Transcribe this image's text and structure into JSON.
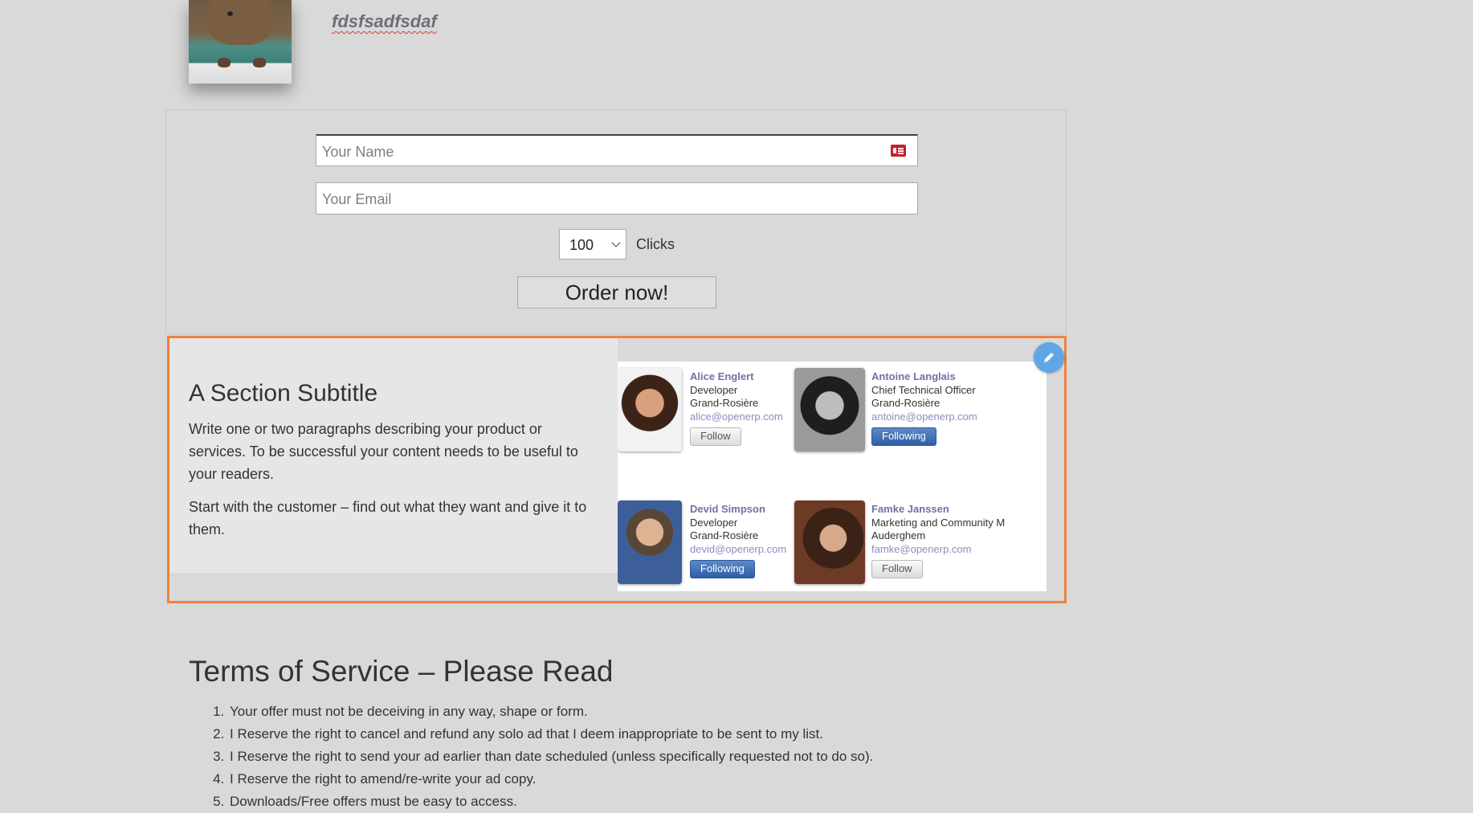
{
  "profile": {
    "name": "fdsfsadfsdaf"
  },
  "order_form": {
    "name_placeholder": "Your Name",
    "email_placeholder": "Your Email",
    "clicks_value": "100",
    "clicks_label": "Clicks",
    "order_button": "Order now!"
  },
  "feature": {
    "subtitle": "A Section Subtitle",
    "paragraph1": "Write one or two paragraphs describing your product or services. To be successful your content needs to be useful to your readers.",
    "paragraph2": "Start with the customer – find out what they want and give it to them.",
    "contacts": [
      {
        "name": "Alice Englert",
        "title": "Developer",
        "location": "Grand-Rosière",
        "email": "alice@openerp.com",
        "button": "Follow"
      },
      {
        "name": "Antoine Langlais",
        "title": "Chief Technical Officer",
        "location": "Grand-Rosière",
        "email": "antoine@openerp.com",
        "button": "Following"
      },
      {
        "name": "Devid Simpson",
        "title": "Developer",
        "location": "Grand-Rosière",
        "email": "devid@openerp.com",
        "button": "Following"
      },
      {
        "name": "Famke Janssen",
        "title": "Marketing and Community M",
        "location": "Auderghem",
        "email": "famke@openerp.com",
        "button": "Follow"
      }
    ]
  },
  "tos": {
    "title": "Terms of Service – Please Read",
    "items": [
      "Your offer must not be deceiving in any way, shape or form.",
      "I Reserve the right to cancel and refund any solo ad that I deem inappropriate to be sent to my list.",
      "I Reserve the right to send your ad earlier than date scheduled (unless specifically requested not to do so).",
      "I Reserve the right to amend/re-write your ad copy.",
      "Downloads/Free offers must be easy to access."
    ]
  },
  "colors": {
    "accent_border": "#f0813d",
    "edit_button": "#5fa6e6",
    "follow_active": "#2c5ea6",
    "id_icon": "#c51f2b"
  }
}
